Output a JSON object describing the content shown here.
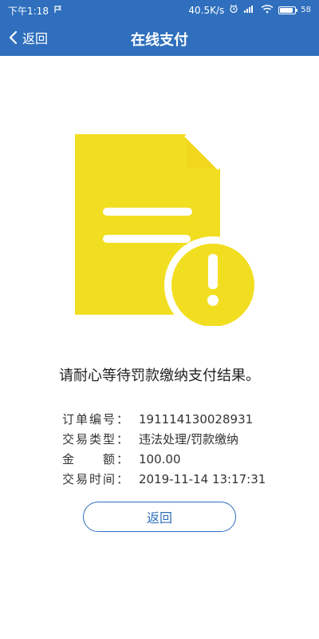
{
  "colors": {
    "primary": "#2f6fbd",
    "warning_yellow": "#f2de20",
    "text": "#333333"
  },
  "status_bar": {
    "time": "下午1:18",
    "left_icon": "flag-icon",
    "speed": "40.5K/s",
    "icons": [
      "alarm-icon",
      "signal-icon",
      "wifi-icon",
      "battery-icon"
    ],
    "battery_text": "58"
  },
  "header": {
    "back_label": "返回",
    "title": "在线支付"
  },
  "main": {
    "message": "请耐心等待罚款缴纳支付结果。",
    "details": [
      {
        "label": "订单编号：",
        "value": "191114130028931"
      },
      {
        "label": "交易类型：",
        "value": "违法处理/罚款缴纳"
      },
      {
        "label": "金　　额：",
        "value": "100.00"
      },
      {
        "label": "交易时间：",
        "value": "2019-11-14 13:17:31"
      }
    ],
    "button_label": "返回"
  }
}
